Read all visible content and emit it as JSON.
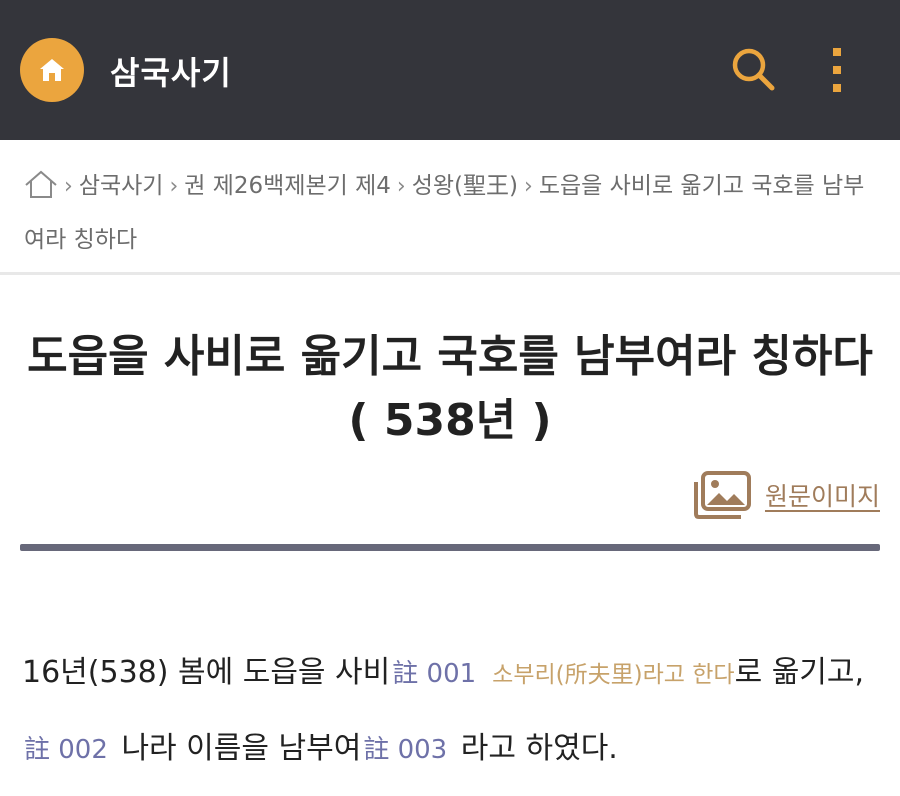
{
  "app": {
    "title": "삼국사기",
    "accent": "#eba53e",
    "header_bg": "#34353b"
  },
  "header": {
    "home_icon": "home-icon",
    "search_icon": "search-icon",
    "more_icon": "more-vertical-icon"
  },
  "breadcrumb": {
    "items": [
      "삼국사기",
      "권 제26백제본기 제4",
      "성왕(聖王)",
      "도읍을 사비로 옮기고 국호를 남부여라 칭하다"
    ]
  },
  "article": {
    "title": "도읍을 사비로 옮기고 국호를 남부여라 칭하다",
    "year": "( 538년 )",
    "original_image_label": "원문이미지"
  },
  "body": {
    "p1": "16년(538) 봄에 도읍을 사비",
    "note1": "註 001",
    "note1_text": "소부리(所夫里)라고 한다",
    "p2": "로 옮기고,",
    "note2": "註 002",
    "p3": " 나라 이름을 남부여",
    "note3": "註 003",
    "p4": " 라고 하였다."
  }
}
